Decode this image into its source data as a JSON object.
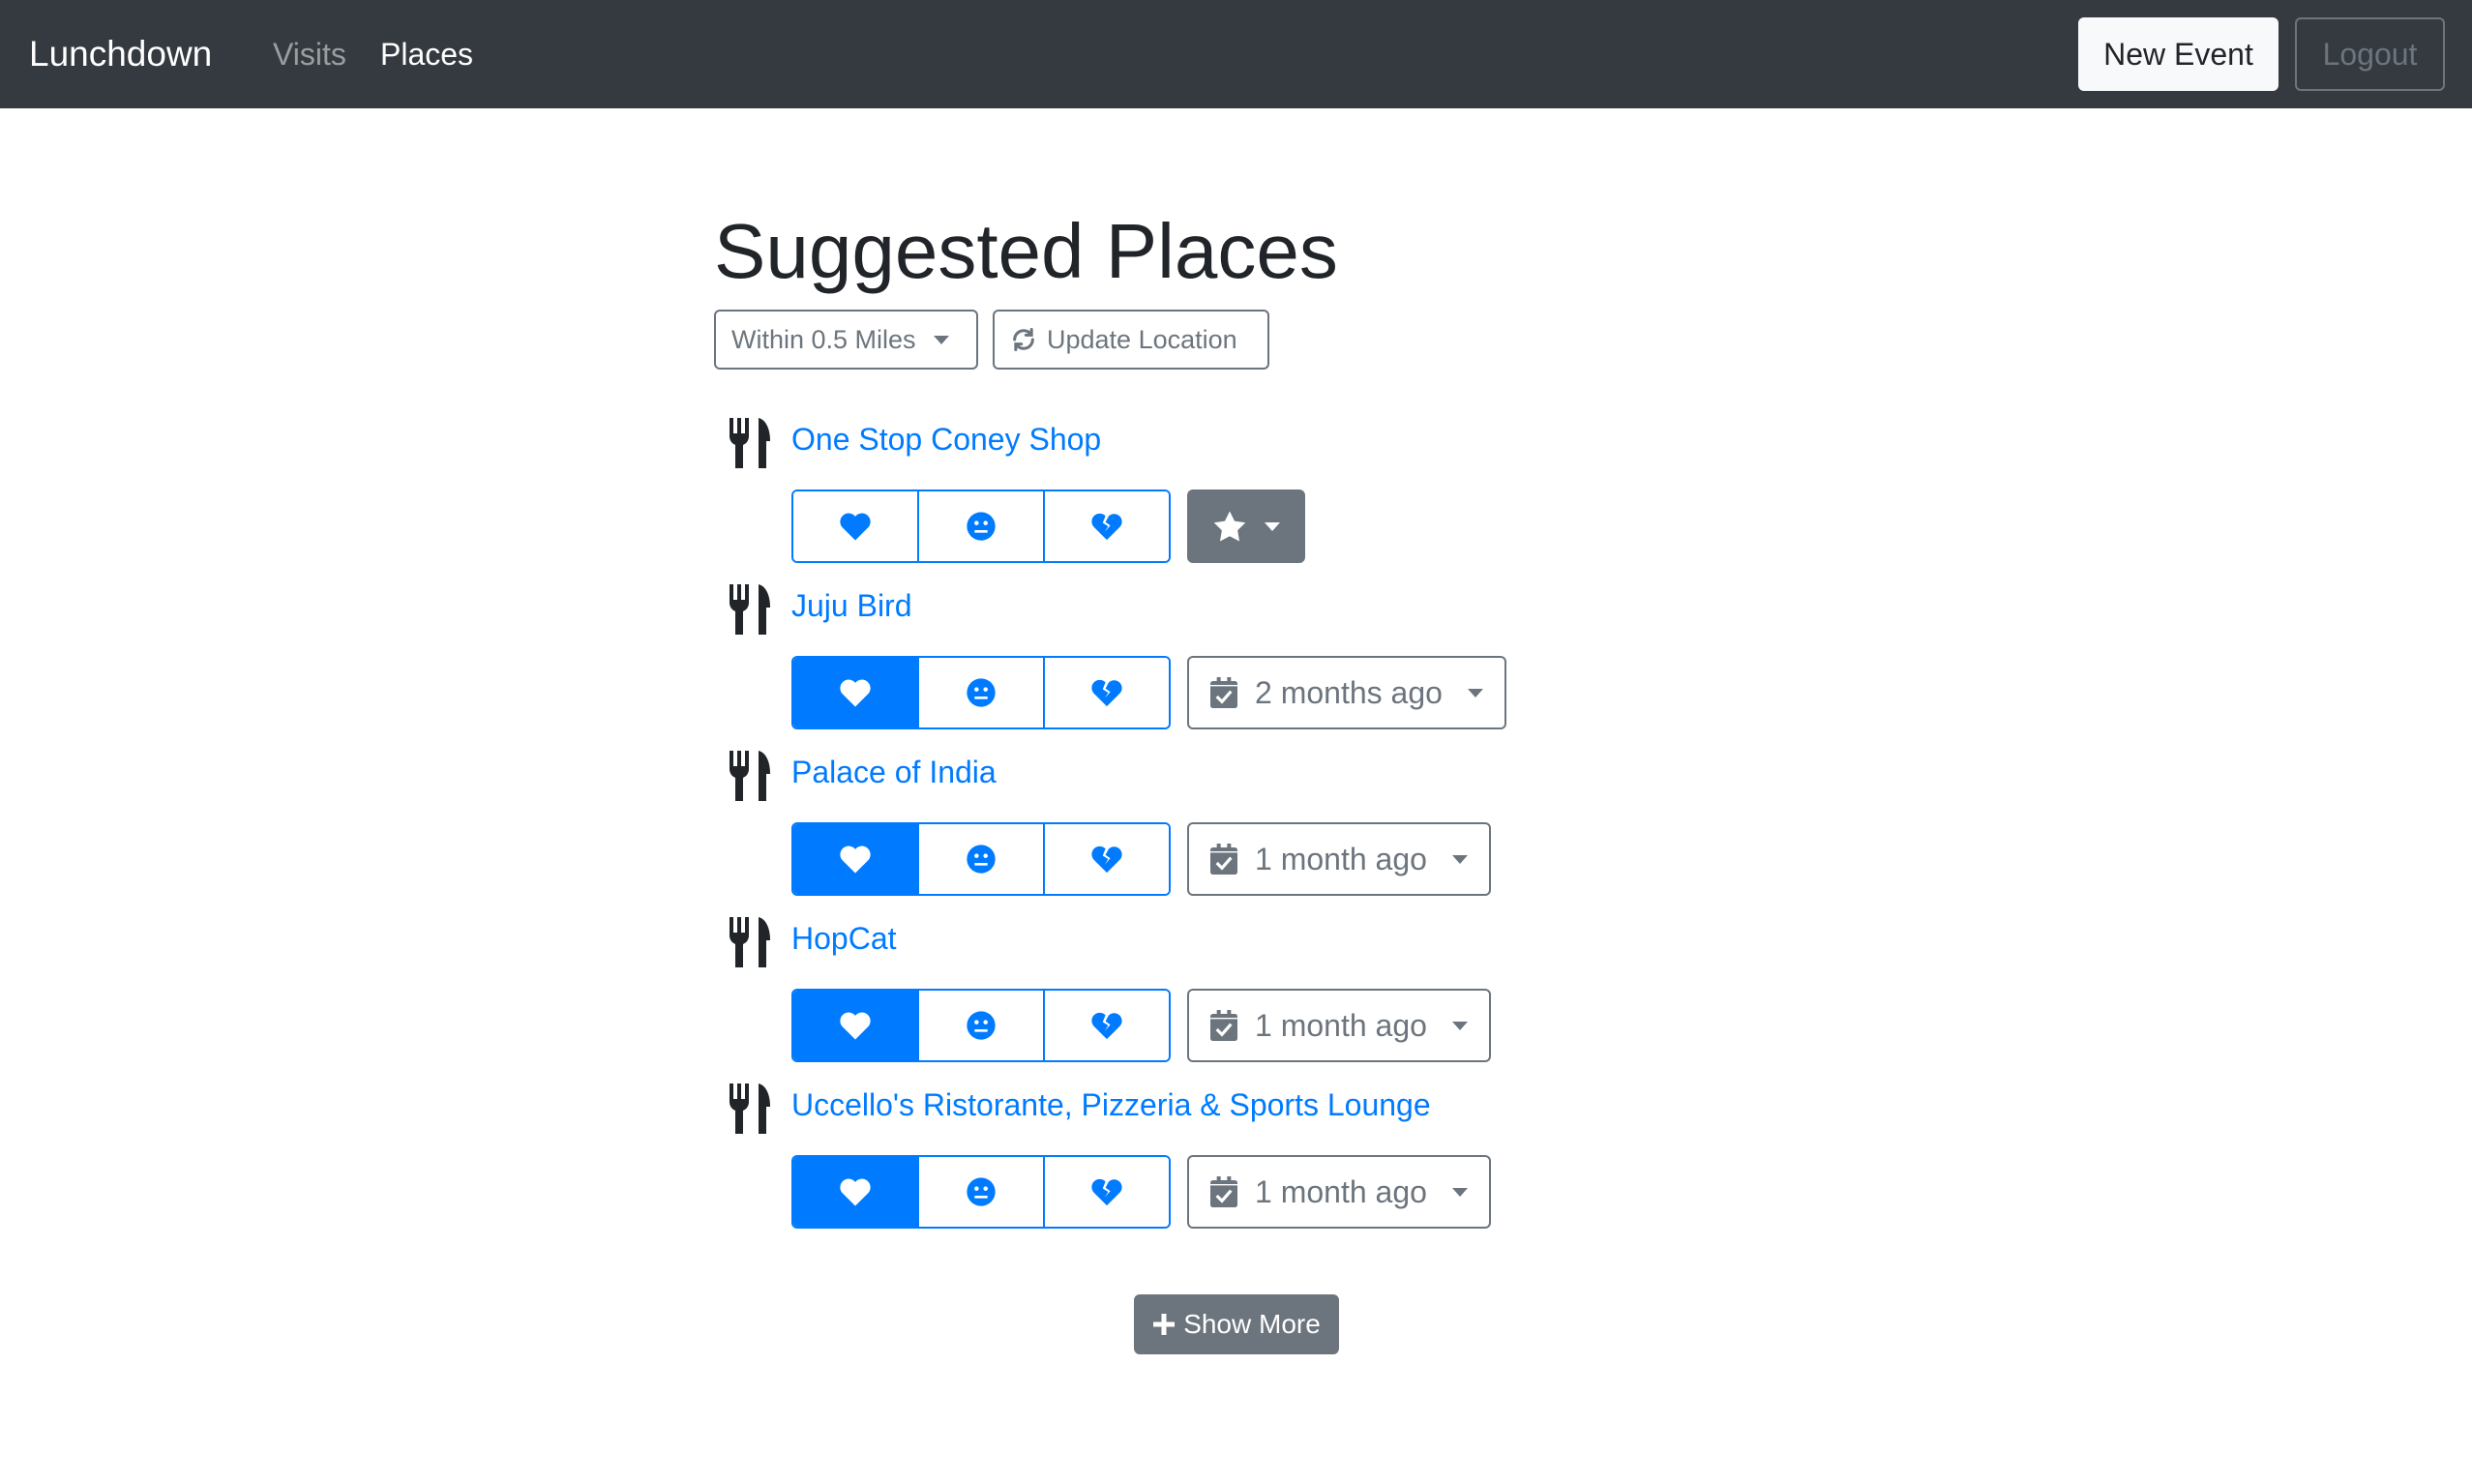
{
  "navbar": {
    "brand": "Lunchdown",
    "links": [
      {
        "label": "Visits"
      },
      {
        "label": "Places"
      }
    ],
    "new_event_label": "New Event",
    "logout_label": "Logout"
  },
  "page": {
    "title": "Suggested Places",
    "distance_filter": "Within 0.5 Miles",
    "update_location": "Update Location",
    "show_more": "Show More"
  },
  "places": [
    {
      "name": "One Stop Coney Shop",
      "rating": "none",
      "last_visit": ""
    },
    {
      "name": "Juju Bird",
      "rating": "love",
      "last_visit": "2 months ago"
    },
    {
      "name": "Palace of India",
      "rating": "love",
      "last_visit": "1 month ago"
    },
    {
      "name": "HopCat",
      "rating": "love",
      "last_visit": "1 month ago"
    },
    {
      "name": "Uccello's Ristorante, Pizzeria & Sports Lounge",
      "rating": "love",
      "last_visit": "1 month ago"
    }
  ],
  "icons": {
    "place": "utensils-icon",
    "love": "heart-icon",
    "meh": "meh-face-icon",
    "hate": "broken-heart-icon",
    "visit": "calendar-check-icon",
    "no_visit": "star-icon",
    "refresh": "sync-icon",
    "add": "plus-icon"
  },
  "colors": {
    "navbar": "#343a40",
    "primary": "#007bff",
    "secondary": "#6c757d",
    "light": "#f8f9fa"
  }
}
